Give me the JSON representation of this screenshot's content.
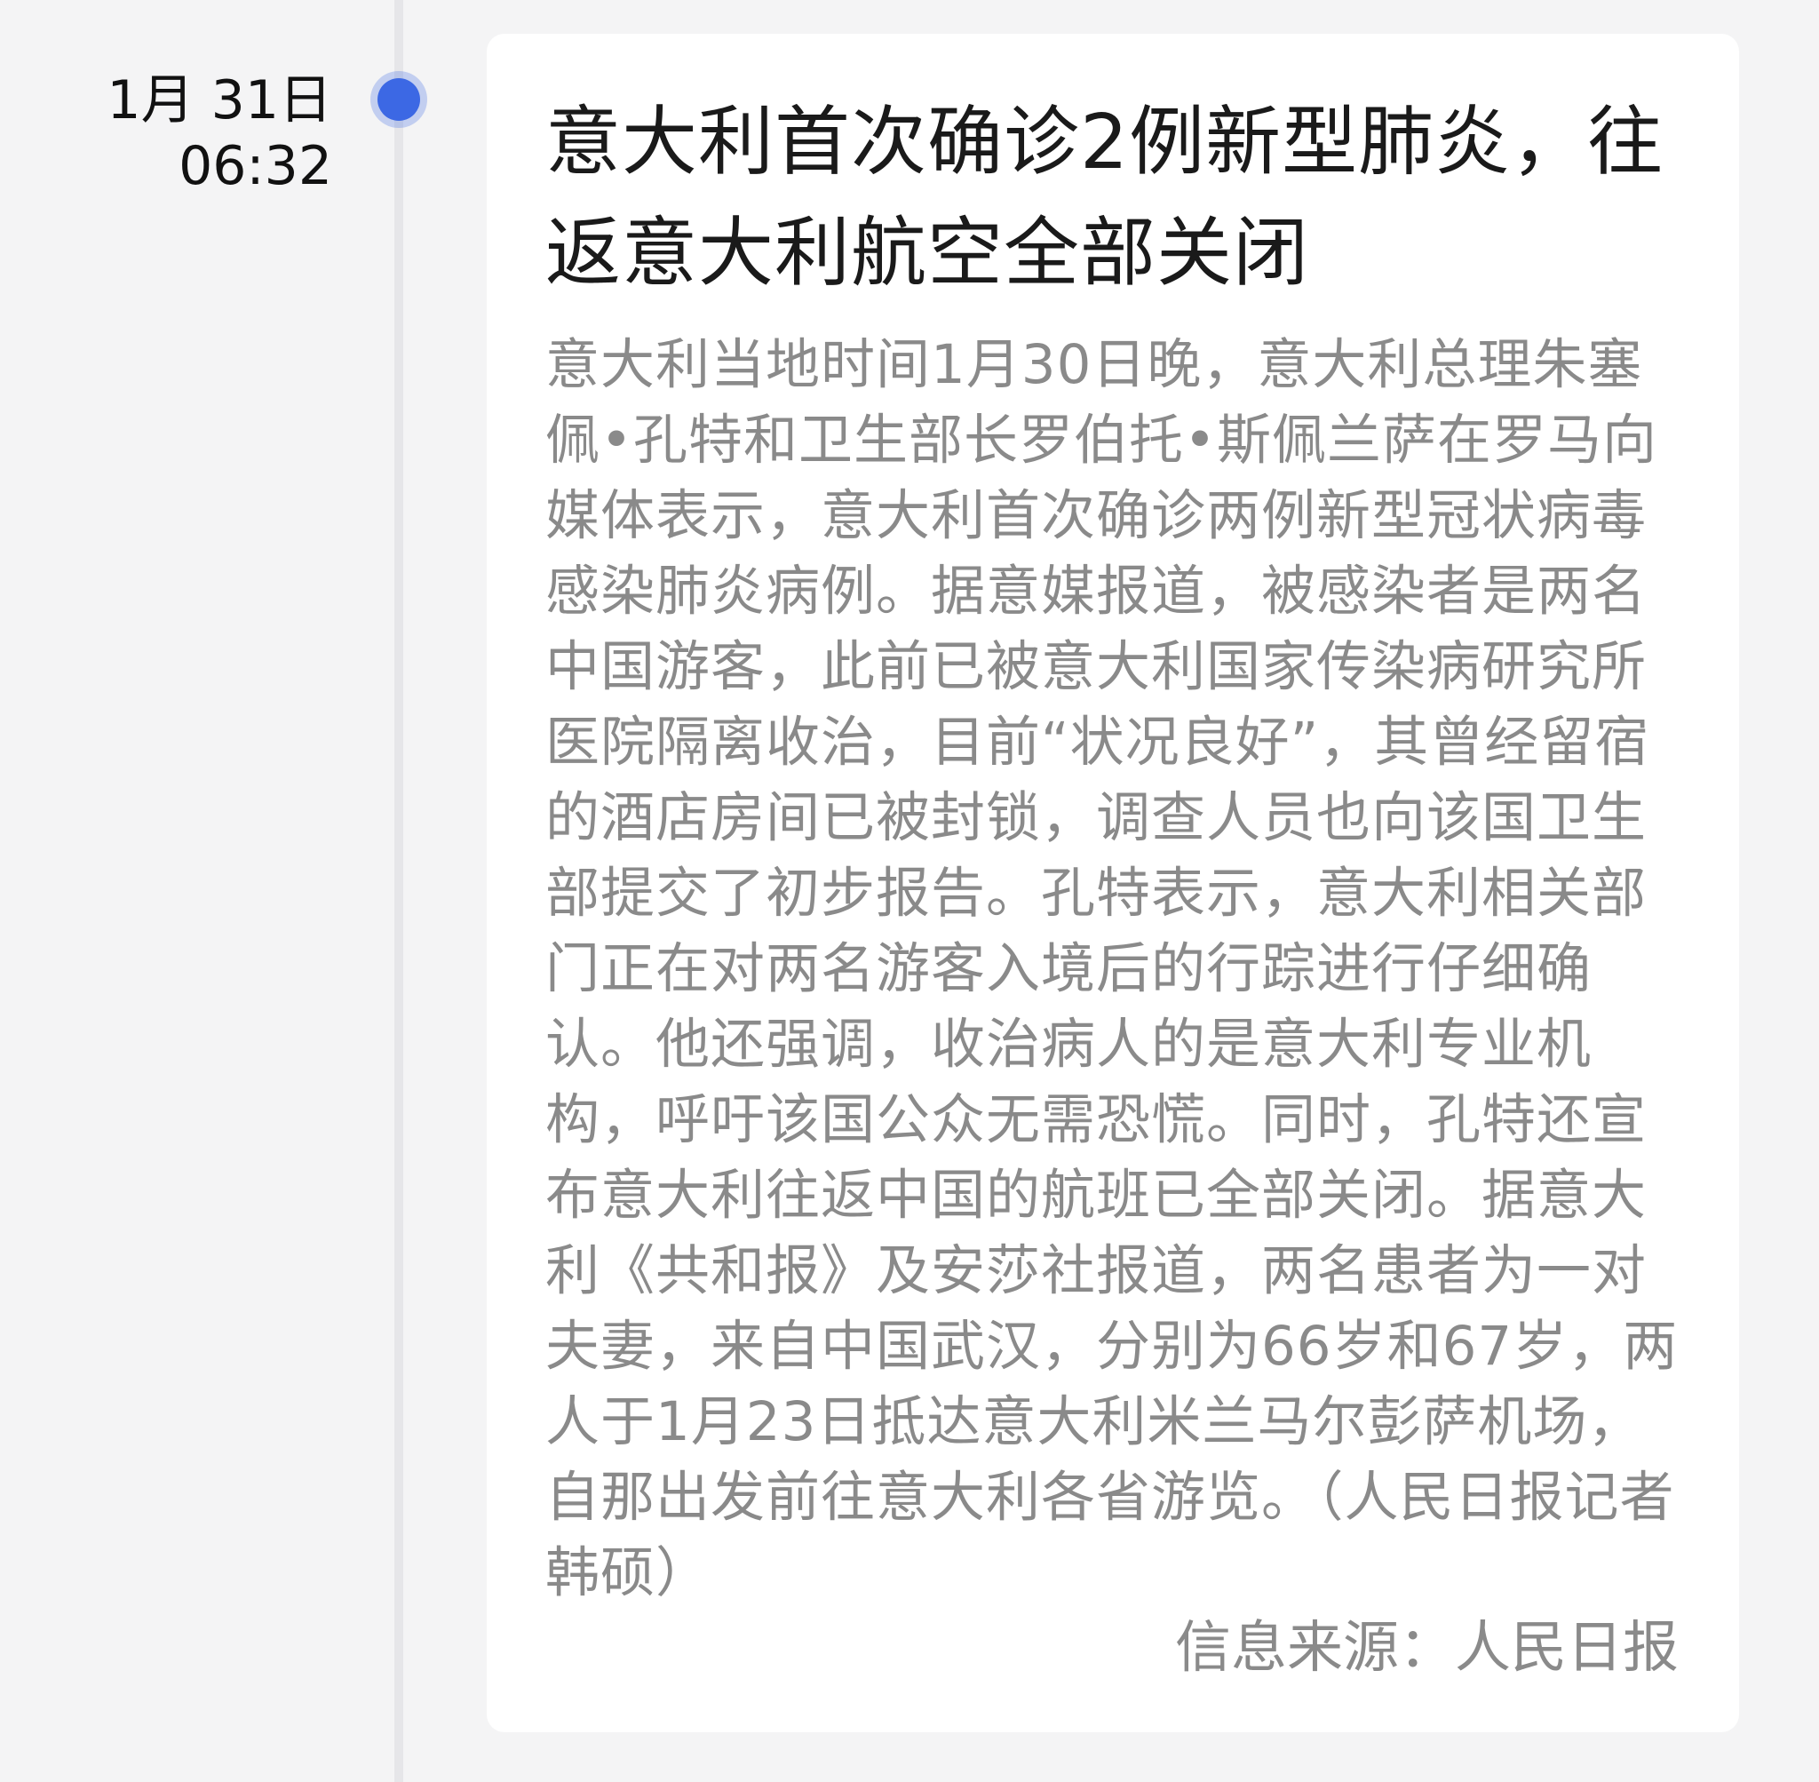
{
  "timeline": {
    "date": "1月 31日",
    "time": "06:32",
    "dot_color": "#3c68e4"
  },
  "news": {
    "title": "意大利首次确诊2例新型肺炎，往返意大利航空全部关闭",
    "body": "意大利当地时间1月30日晚，意大利总理朱塞佩•孔特和卫生部长罗伯托•斯佩兰萨在罗马向媒体表示，意大利首次确诊两例新型冠状病毒感染肺炎病例。据意媒报道，被感染者是两名中国游客，此前已被意大利国家传染病研究所医院隔离收治，目前“状况良好”，其曾经留宿的酒店房间已被封锁，调查人员也向该国卫生部提交了初步报告。孔特表示，意大利相关部门正在对两名游客入境后的行踪进行仔细确认。他还强调，收治病人的是意大利专业机构，呼吁该国公众无需恐慌。同时，孔特还宣布意大利往返中国的航班已全部关闭。据意大利《共和报》及安莎社报道，两名患者为一对夫妻，来自中国武汉，分别为66岁和67岁，两人于1月23日抵达意大利米兰马尔彭萨机场，自那出发前往意大利各省游览。（人民日报记者韩硕）",
    "source": "信息来源：人民日报"
  }
}
